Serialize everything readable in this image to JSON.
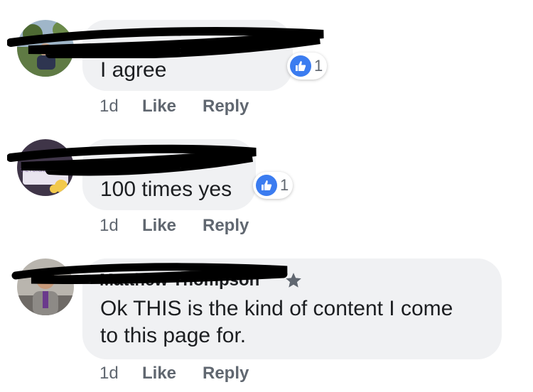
{
  "comments": [
    {
      "name": "",
      "text": "I agree",
      "reaction_icon": "thumbs-up-icon",
      "reaction_count": "1",
      "time": "1d",
      "like_label": "Like",
      "reply_label": "Reply"
    },
    {
      "name": "",
      "text": "100 times yes",
      "reaction_icon": "thumbs-up-icon",
      "reaction_count": "1",
      "time": "1d",
      "like_label": "Like",
      "reply_label": "Reply"
    },
    {
      "name": "Matthew Thompson",
      "badge_icon": "star-icon",
      "text_line1": "Ok THIS is the kind of content I come",
      "text_line2": "to this page for.",
      "time": "1d",
      "like_label": "Like",
      "reply_label": "Reply"
    }
  ],
  "avatar_2_caption": "THE FUTURE IS FEMALE",
  "colors": {
    "bubble": "#f0f1f3",
    "like_blue": "#3b7cf0",
    "meta_gray": "#606770",
    "text": "#1c1e21"
  }
}
